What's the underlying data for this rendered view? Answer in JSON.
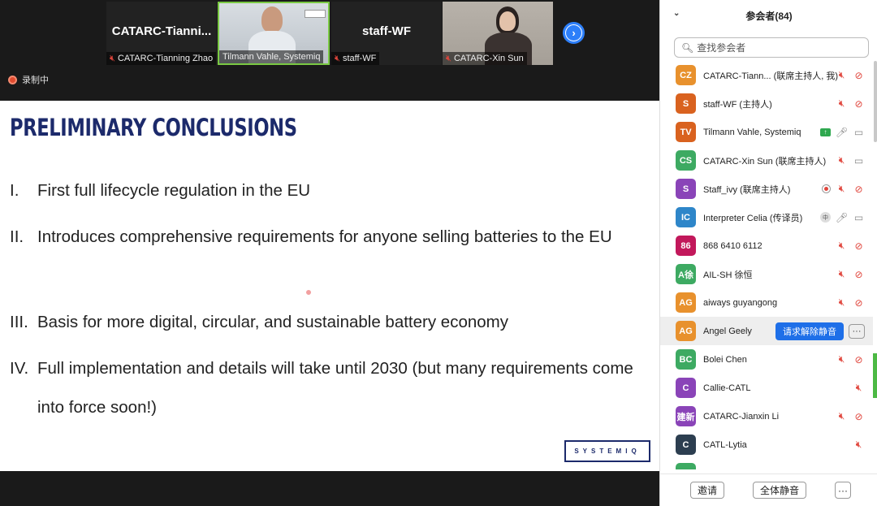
{
  "video_tiles": [
    {
      "name": "CATARC-Tianni...",
      "label": "CATARC-Tianning Zhao",
      "muted": true
    },
    {
      "name": "",
      "label": "Tilmann Vahle, Systemiq",
      "muted": false
    },
    {
      "name": "staff-WF",
      "label": "staff-WF",
      "muted": true
    },
    {
      "name": "",
      "label": "CATARC-Xin Sun",
      "muted": true
    }
  ],
  "recording_label": "录制中",
  "slide": {
    "title": "PRELIMINARY CONCLUSIONS",
    "points": [
      {
        "num": "I.",
        "text": "First full lifecycle regulation in the EU"
      },
      {
        "num": "II.",
        "text": "Introduces comprehensive requirements for anyone selling batteries to the EU"
      },
      {
        "num": "III.",
        "text": "Basis for more digital, circular, and sustainable battery economy"
      },
      {
        "num": "IV.",
        "text": "Full implementation and details will take until 2030 (but many requirements come into force soon!)"
      }
    ],
    "logo": "SYSTEMIQ"
  },
  "panel": {
    "title": "参会者(84)",
    "search_placeholder": "查找参会者",
    "participants": [
      {
        "initials": "CZ",
        "name": "CATARC-Tiann... (联席主持人, 我)",
        "color": "#e8912d"
      },
      {
        "initials": "S",
        "name": "staff-WF (主持人)",
        "color": "#d9621f"
      },
      {
        "initials": "TV",
        "name": "Tilmann Vahle, Systemiq",
        "color": "#d9621f"
      },
      {
        "initials": "CS",
        "name": "CATARC-Xin Sun (联席主持人)",
        "color": "#3daa62"
      },
      {
        "initials": "S",
        "name": "Staff_ivy (联席主持人)",
        "color": "#8a44b8"
      },
      {
        "initials": "IC",
        "name": "Interpreter Celia (传译员)",
        "color": "#2e86c9"
      },
      {
        "initials": "86",
        "name": "868 6410 6112",
        "color": "#c2185b"
      },
      {
        "initials": "A徐",
        "name": "AIL-SH 徐恒",
        "color": "#3daa62"
      },
      {
        "initials": "AG",
        "name": "aiways guyangong",
        "color": "#e8912d"
      },
      {
        "initials": "AG",
        "name": "Angel Geely",
        "color": "#e8912d"
      },
      {
        "initials": "BC",
        "name": "Bolei Chen",
        "color": "#3daa62"
      },
      {
        "initials": "C",
        "name": "Callie-CATL",
        "color": "#8a44b8"
      },
      {
        "initials": "建新",
        "name": "CATARC-Jianxin Li",
        "color": "#8a44b8"
      },
      {
        "initials": "C",
        "name": "CATL-Lytia",
        "color": "#2c3e50"
      }
    ],
    "unmute_request_label": "请求解除静音",
    "more_label": "···",
    "invite_label": "邀请",
    "mute_all_label": "全体静音",
    "footer_more_label": "···"
  },
  "colors": {
    "accent": "#1e6fe8",
    "slide_title": "#1c2a6b",
    "muted_red": "#e0453c"
  }
}
